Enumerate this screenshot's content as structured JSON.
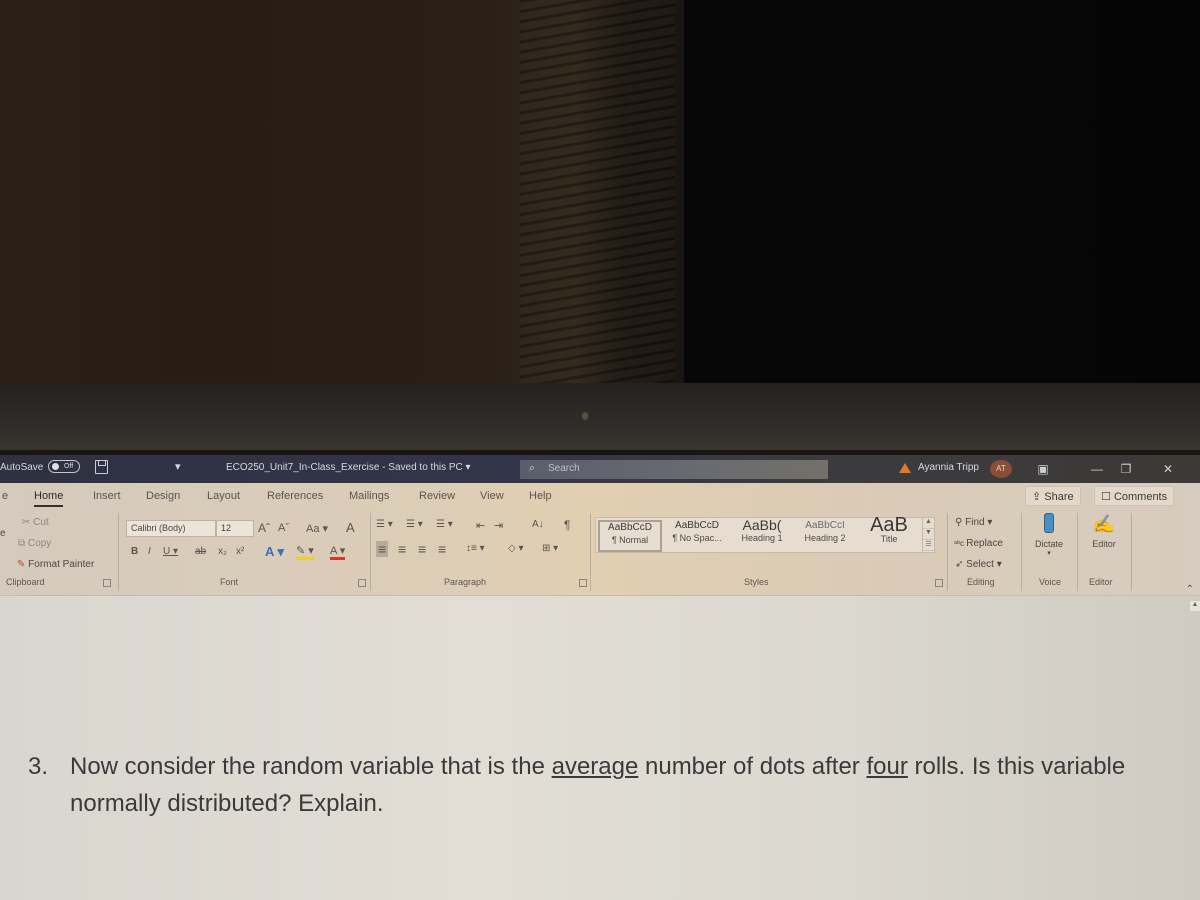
{
  "titlebar": {
    "autosave_label": "AutoSave",
    "autosave_state": "Off",
    "qat_more": "▾",
    "doc_title": "ECO250_Unit7_In-Class_Exercise  -  Saved to this PC  ▾",
    "search_placeholder": "Search",
    "search_icon": "⌕",
    "warning_icon": "warning",
    "user_name": "Ayannia Tripp",
    "user_initials": "AT",
    "ribbon_display_icon": "▣",
    "minimize_icon": "—",
    "restore_icon": "❐",
    "close_icon": "✕"
  },
  "tabs": [
    {
      "label": "e"
    },
    {
      "label": "Home",
      "active": true
    },
    {
      "label": "Insert"
    },
    {
      "label": "Design"
    },
    {
      "label": "Layout"
    },
    {
      "label": "References"
    },
    {
      "label": "Mailings"
    },
    {
      "label": "Review"
    },
    {
      "label": "View"
    },
    {
      "label": "Help"
    }
  ],
  "share": {
    "icon": "⇪",
    "label": "Share"
  },
  "comments": {
    "icon": "☐",
    "label": "Comments"
  },
  "clipboard": {
    "cut": "Cut",
    "copy": "Copy",
    "format_painter": "Format Painter",
    "paste_partial": "e",
    "label": "Clipboard"
  },
  "font": {
    "name": "Calibri (Body)",
    "size": "12",
    "grow": "Aˆ",
    "shrink": "Aˇ",
    "change_case": "Aa ▾",
    "clear_formatting": "A",
    "bold": "B",
    "italic": "I",
    "underline": "U ▾",
    "strikethrough": "ab",
    "subscript": "x₂",
    "superscript": "x²",
    "text_effects": "A ▾",
    "highlight": "✎ ▾",
    "font_color": "A ▾",
    "label": "Font",
    "highlight_color": "#f0d020",
    "font_color_bar": "#d9362b"
  },
  "paragraph": {
    "bullets": "☰ ▾",
    "numbering": "☰ ▾",
    "multilevel": "☰ ▾",
    "decrease_indent": "⇤",
    "increase_indent": "⇥",
    "sort": "A↓",
    "show_marks": "¶",
    "align_left": "≡",
    "center": "≡",
    "align_right": "≡",
    "justify": "≡",
    "line_spacing": "↕≡ ▾",
    "shading": "◇ ▾",
    "borders": "⊞ ▾",
    "label": "Paragraph"
  },
  "styles": {
    "items": [
      {
        "sample": "AaBbCcD",
        "name": "¶ Normal",
        "selected": true
      },
      {
        "sample": "AaBbCcD",
        "name": "¶ No Spac..."
      },
      {
        "sample": "AaBb(",
        "name": "Heading 1"
      },
      {
        "sample": "AaBbCcI",
        "name": "Heading 2"
      },
      {
        "sample": "AaB",
        "name": "Title"
      }
    ],
    "label": "Styles"
  },
  "editing": {
    "find": "Find ▾",
    "replace": "Replace",
    "select": "Select ▾",
    "label": "Editing"
  },
  "voice": {
    "dictate": "Dictate",
    "dictate_arrow": "▾",
    "label": "Voice"
  },
  "editor": {
    "editor": "Editor",
    "label": "Editor"
  },
  "document": {
    "number": "3.",
    "text_before": "Now consider the random variable that is the ",
    "underline_1": "average",
    "text_middle": " number of dots after ",
    "underline_2": "four",
    "text_after": " rolls. Is this variable normally distributed? Explain."
  }
}
